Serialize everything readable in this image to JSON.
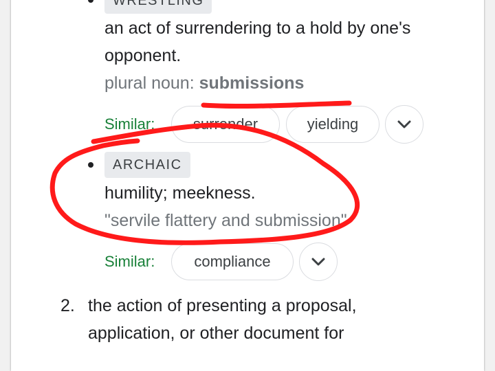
{
  "sense_wrestling": {
    "label": "WRESTLING",
    "definition_line1": "an act of surrendering to a hold by one's",
    "definition_line2": "opponent.",
    "plural_prefix": "plural noun: ",
    "plural_word": "submissions",
    "similar_label": "Similar:",
    "similar_words": [
      "surrender",
      "yielding"
    ]
  },
  "sense_archaic": {
    "label": "ARCHAIC",
    "definition": "humility; meekness.",
    "example": "\"servile flattery and submission\"",
    "similar_label": "Similar:",
    "similar_words": [
      "compliance"
    ]
  },
  "sense_2": {
    "number": "2.",
    "definition_line1": "the action of presenting a proposal,",
    "definition_line2": "application, or other document for"
  },
  "icons": {
    "expand": "chevron-down-icon"
  },
  "colors": {
    "similar_label": "#188038",
    "annotation": "#ff1a1a",
    "chip_border": "#dadce0",
    "muted_text": "#70757a"
  }
}
